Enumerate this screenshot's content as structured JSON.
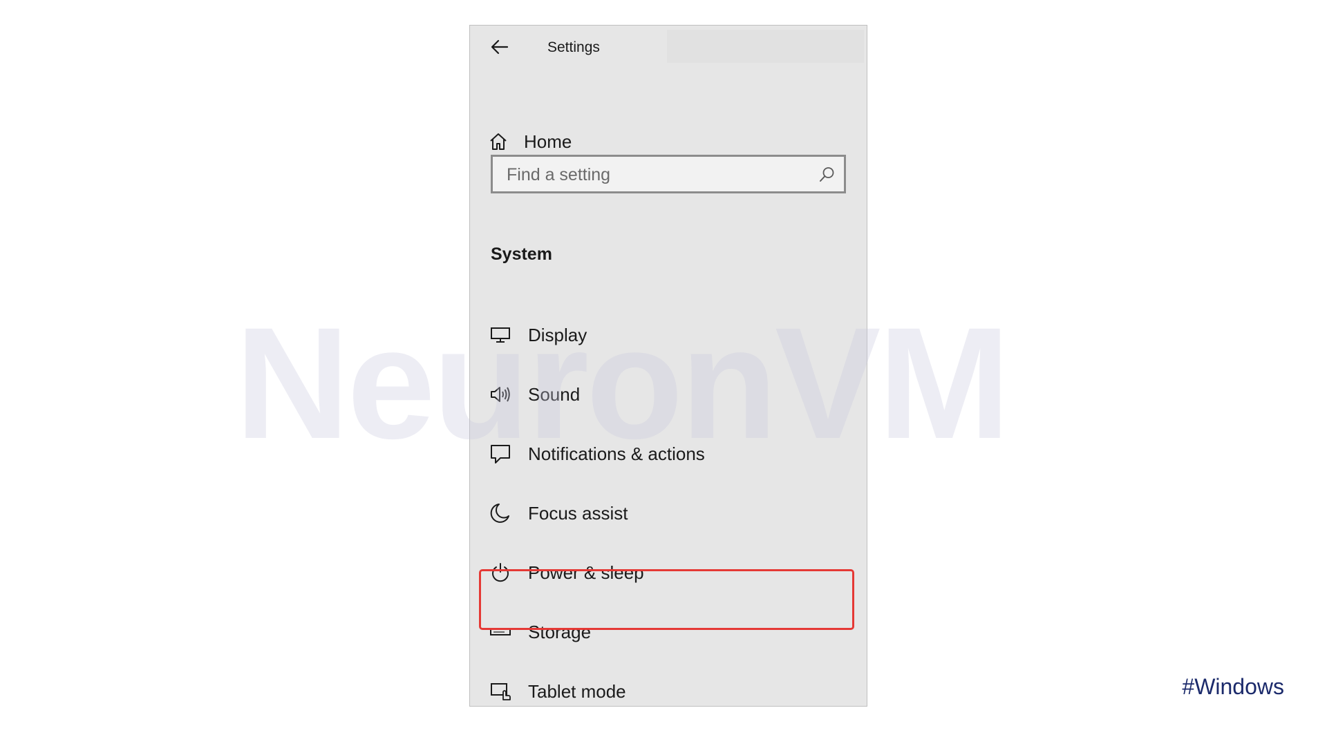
{
  "window": {
    "title": "Settings",
    "back_icon": "arrow-left-icon"
  },
  "home": {
    "label": "Home",
    "icon": "home-icon"
  },
  "search": {
    "placeholder": "Find a setting",
    "value": "",
    "icon": "search-icon"
  },
  "section": {
    "heading": "System"
  },
  "nav": {
    "items": [
      {
        "label": "Display",
        "icon": "monitor-icon"
      },
      {
        "label": "Sound",
        "icon": "speaker-icon"
      },
      {
        "label": "Notifications & actions",
        "icon": "chat-bubble-icon"
      },
      {
        "label": "Focus assist",
        "icon": "moon-icon"
      },
      {
        "label": "Power & sleep",
        "icon": "power-icon"
      },
      {
        "label": "Storage",
        "icon": "storage-drive-icon",
        "highlighted": true
      },
      {
        "label": "Tablet mode",
        "icon": "tablet-mode-icon"
      }
    ]
  },
  "annotation": {
    "highlight_color": "#e53935"
  },
  "watermark": {
    "text": "NeuronVM"
  },
  "hashtag": {
    "text": "#Windows"
  }
}
